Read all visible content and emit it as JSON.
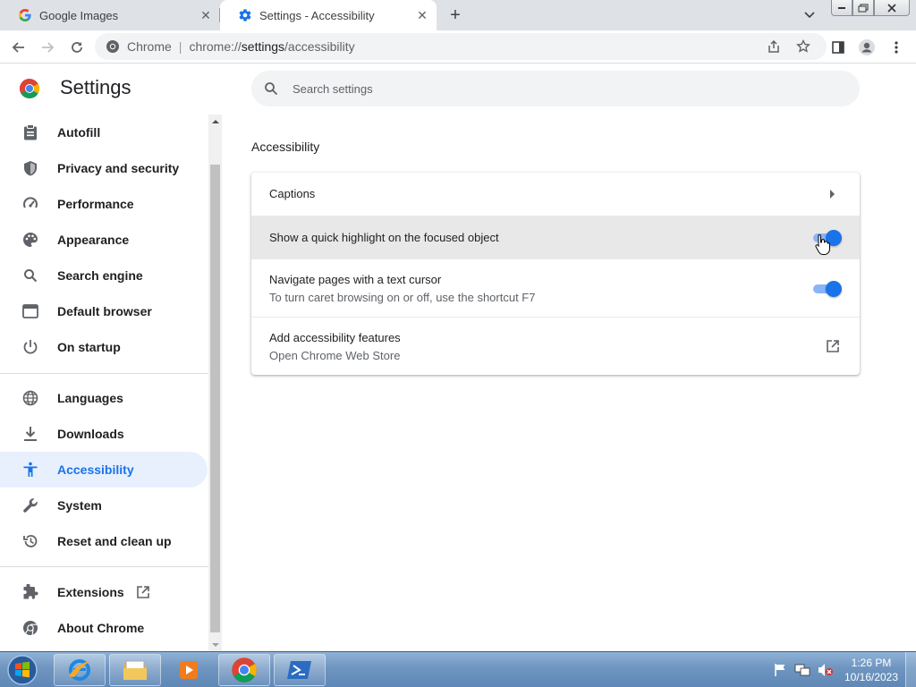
{
  "tabs": [
    {
      "title": "Google Images",
      "icon": "google-g-icon",
      "active": false
    },
    {
      "title": "Settings - Accessibility",
      "icon": "settings-gear-icon",
      "active": true
    }
  ],
  "omnibox": {
    "site_label": "Chrome",
    "url_scheme": "chrome://",
    "url_host": "settings",
    "url_path": "/accessibility"
  },
  "header": {
    "title": "Settings",
    "search_placeholder": "Search settings"
  },
  "sidebar": {
    "items": [
      {
        "label": "Autofill",
        "icon": "clipboard-icon"
      },
      {
        "label": "Privacy and security",
        "icon": "shield-icon"
      },
      {
        "label": "Performance",
        "icon": "speedometer-icon"
      },
      {
        "label": "Appearance",
        "icon": "palette-icon"
      },
      {
        "label": "Search engine",
        "icon": "search-icon"
      },
      {
        "label": "Default browser",
        "icon": "browser-window-icon"
      },
      {
        "label": "On startup",
        "icon": "power-icon"
      },
      {
        "label": "Languages",
        "icon": "globe-icon"
      },
      {
        "label": "Downloads",
        "icon": "download-icon"
      },
      {
        "label": "Accessibility",
        "icon": "accessibility-icon",
        "active": true
      },
      {
        "label": "System",
        "icon": "wrench-icon"
      },
      {
        "label": "Reset and clean up",
        "icon": "restore-icon"
      },
      {
        "label": "Extensions",
        "icon": "puzzle-icon"
      },
      {
        "label": "About Chrome",
        "icon": "chrome-icon"
      }
    ]
  },
  "main": {
    "section_title": "Accessibility",
    "rows": [
      {
        "label": "Captions",
        "control": "arrow"
      },
      {
        "label": "Show a quick highlight on the focused object",
        "control": "toggle",
        "enabled": true
      },
      {
        "label": "Navigate pages with a text cursor",
        "sub": "To turn caret browsing on or off, use the shortcut F7",
        "control": "toggle",
        "enabled": true
      },
      {
        "label": "Add accessibility features",
        "sub": "Open Chrome Web Store",
        "control": "external-link"
      }
    ]
  },
  "taskbar": {
    "time": "1:26 PM",
    "date": "10/16/2023"
  },
  "colors": {
    "accent": "#1a73e8",
    "toggle_track": "#8ab4f8",
    "active_nav_bg": "#e8f0fe"
  }
}
